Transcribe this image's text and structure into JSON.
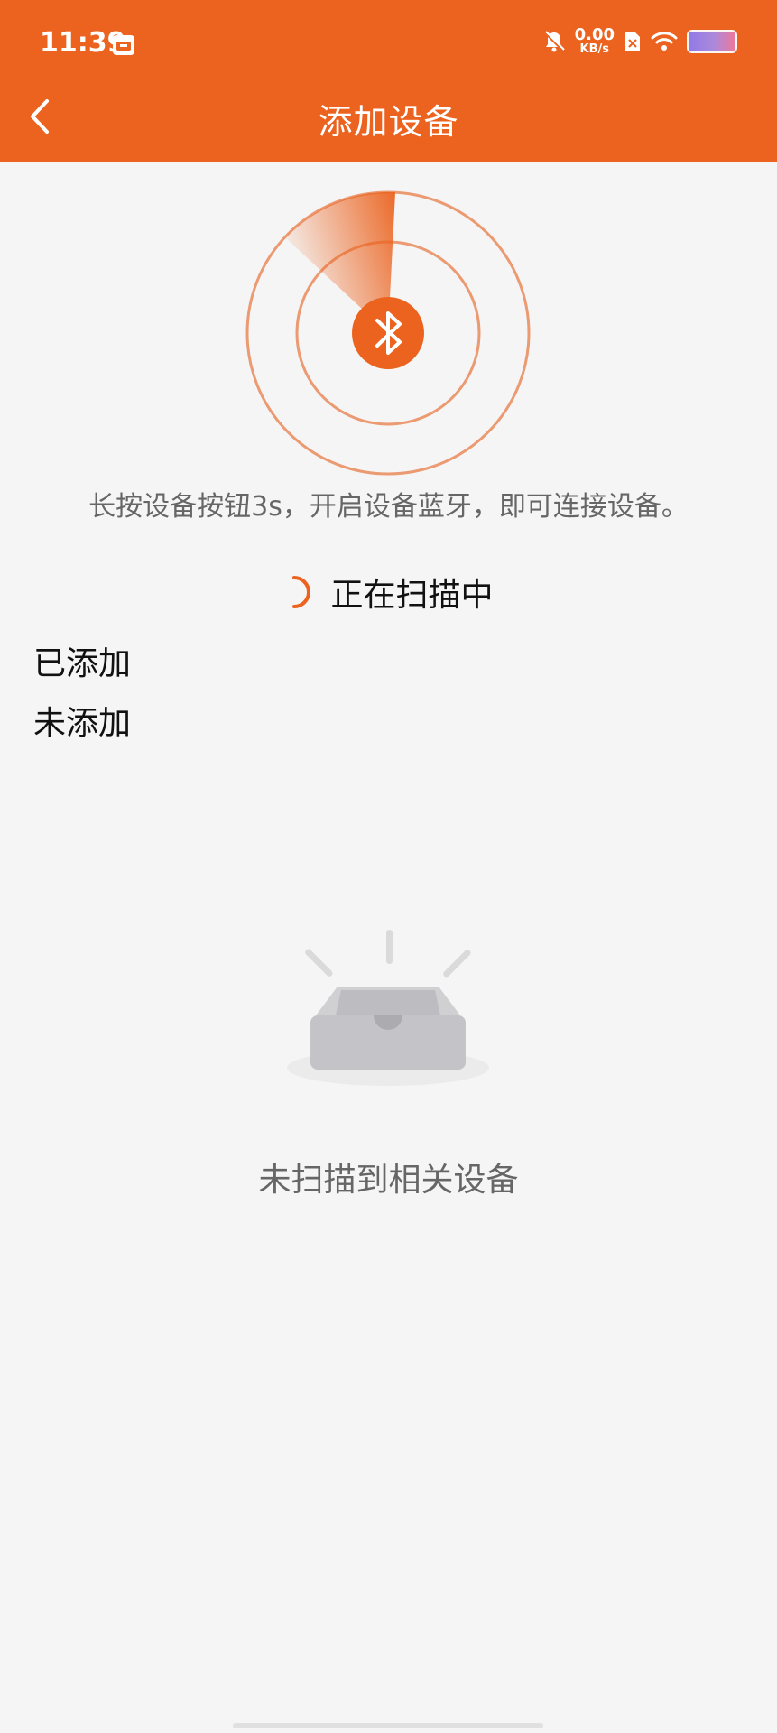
{
  "status_bar": {
    "time": "11:39",
    "net_speed_value": "0.00",
    "net_speed_unit": "KB/s",
    "icons": [
      "calendar-app-icon",
      "mute-icon",
      "sim-off-icon",
      "wifi-icon",
      "battery-icon"
    ]
  },
  "header": {
    "title": "添加设备",
    "back_icon": "chevron-left-icon"
  },
  "scan_panel": {
    "hint": "长按设备按钮3s，开启设备蓝牙，即可连接设备。",
    "status": "正在扫描中",
    "center_icon": "bluetooth-icon"
  },
  "sections": {
    "added": "已添加",
    "not_added": "未添加"
  },
  "empty_state": {
    "icon": "empty-box-icon",
    "text": "未扫描到相关设备"
  },
  "colors": {
    "accent": "#eb631f",
    "background": "#f5f5f5"
  }
}
